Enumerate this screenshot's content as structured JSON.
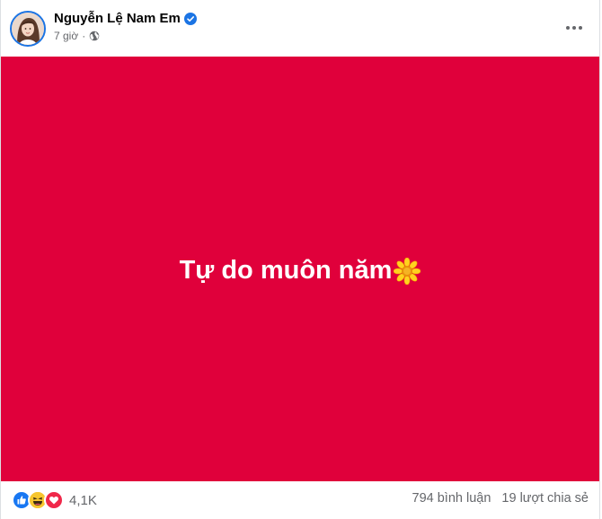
{
  "post": {
    "author_name": "Nguyễn Lệ Nam Em",
    "timestamp": "7 giờ",
    "separator": "·",
    "privacy_icon": "globe-icon",
    "verified_icon": "verified-badge-icon",
    "more_icon": "more-dots-icon",
    "background_color": "#e0003b",
    "status_text": "Tự do muôn năm",
    "status_emoji": "sunflower-icon"
  },
  "footer": {
    "reaction_icons": [
      "like-icon",
      "haha-icon",
      "love-icon"
    ],
    "reaction_count": "4,1K",
    "comments": "794 bình luận",
    "shares": "19 lượt chia sẻ"
  }
}
